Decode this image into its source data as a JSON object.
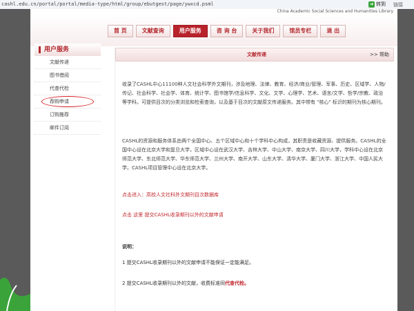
{
  "browser": {
    "address": "cashl.edu.cn/portal/portal/media-type/html/group/ebutgest/page/ywxcd.psml",
    "go_label": "转到",
    "links_label": "链接",
    "go_icon": "go-arrow-icon"
  },
  "site": {
    "banner": "China Academic Social Sciences and Humanities Library",
    "nav": [
      {
        "label": "首  页"
      },
      {
        "label": "文献查询"
      },
      {
        "label": "用户服务"
      },
      {
        "label": "咨 询 台"
      },
      {
        "label": "关于我们"
      },
      {
        "label": "馆员专栏"
      },
      {
        "label": "退  出"
      }
    ],
    "nav_active_color": "#b8232b"
  },
  "sidebar": {
    "title": "用户服务",
    "items": [
      {
        "label": "文献传递"
      },
      {
        "label": "图书借阅"
      },
      {
        "label": "代查代检"
      },
      {
        "label": "荐购申请"
      },
      {
        "label": "订购推荐"
      },
      {
        "label": "邮件订阅"
      }
    ]
  },
  "content": {
    "title": "文献传递",
    "help": ">> 帮助",
    "para1": "收录了CASHL中心11100种人文社会科学外文期刊，涉及地理、法律、教育、经济/商业/管理、军事、历史、区域学、人物/传记、社会科学、社会学、体育、统计学、图书馆学/信息科学、文化、文学、心理学、艺术、语言/文学、哲学/宗教、政治等学科。可提供目次的分类浏览和检索查询，以及基于目次的文献原文传递服务。其中带有 \"核心\" 标识的期刊为核心期刊。",
    "para2": "CASHL的资源和服务体系由两个全国中心、五个区域中心和十个学科中心构成，其职责是收藏资源、提供服务。CASHL的全国中心设在北京大学和复旦大学，区域中心设在武汉大学、吉林大学、中山大学、南京大学、四川大学，学科中心设在北京师范大学、东北师范大学、华东师范大学、兰州大学、南开大学、山东大学、清华大学、厦门大学、浙江大学、中国人民大学。CASHL项目管理中心设在北京大学。",
    "link1": "点击进入：高校人文社科外文期刊目次数据库",
    "link2": "点击  这里  提交CASHL收录期刊以外的文献申请",
    "note_title": "说明：",
    "note1": "1 提交CASHL收录期刊以外的文献申请不能保证一定能满足。",
    "note2_prefix": "2 提交CASHL收录期刊以外的文献，收费标准同",
    "note2_emph": "代查代检。"
  }
}
